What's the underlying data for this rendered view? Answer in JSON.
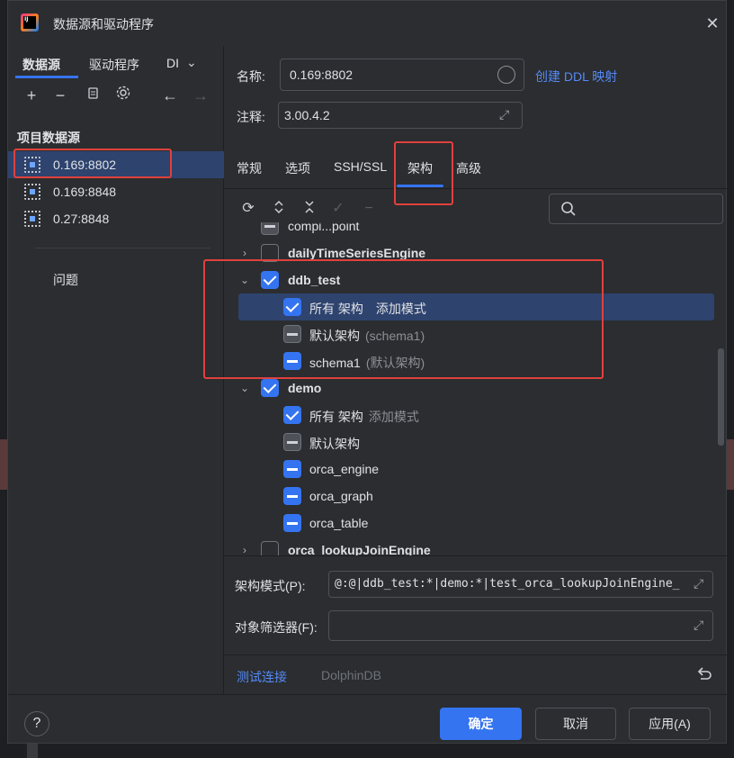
{
  "window": {
    "title": "数据源和驱动程序"
  },
  "left": {
    "tabs": [
      "数据源",
      "驱动程序",
      "DI"
    ],
    "section_title": "项目数据源",
    "datasources": [
      {
        "label": "0.169:8802",
        "selected": true
      },
      {
        "label": "0.169:8848",
        "selected": false
      },
      {
        "label": "0.27:8848",
        "selected": false
      }
    ],
    "problems": "问题"
  },
  "form": {
    "name_label": "名称:",
    "name_value": "0.169:8802",
    "ddl_link": "创建 DDL 映射",
    "comment_label": "注释:",
    "comment_value": "3.00.4.2"
  },
  "tabs": [
    "常规",
    "选项",
    "SSH/SSL",
    "架构",
    "高级"
  ],
  "active_tab": "架构",
  "tree": {
    "rows": [
      {
        "label": "compi...point",
        "level": 0,
        "check": "partial-gray"
      },
      {
        "label": "dailyTimeSeriesEngine",
        "level": 0,
        "check": "unchecked",
        "expand": "collapsed",
        "bold": true
      },
      {
        "label": "ddb_test",
        "level": 0,
        "check": "checked",
        "expand": "expanded",
        "bold": true
      },
      {
        "label": "所有 架构",
        "hint": "添加模式",
        "level": 1,
        "check": "checked",
        "selected": true
      },
      {
        "label": "默认架构",
        "hint": "(schema1)",
        "level": 1,
        "check": "partial-gray"
      },
      {
        "label": "schema1",
        "hint": "(默认架构)",
        "level": 1,
        "check": "partial-blue"
      },
      {
        "label": "demo",
        "level": 0,
        "check": "checked",
        "expand": "expanded",
        "bold": true
      },
      {
        "label": "所有 架构",
        "hint": "添加模式",
        "level": 1,
        "check": "checked"
      },
      {
        "label": "默认架构",
        "level": 1,
        "check": "partial-gray"
      },
      {
        "label": "orca_engine",
        "level": 1,
        "check": "partial-blue"
      },
      {
        "label": "orca_graph",
        "level": 1,
        "check": "partial-blue"
      },
      {
        "label": "orca_table",
        "level": 1,
        "check": "partial-blue"
      },
      {
        "label": "orca_lookupJoinEngine",
        "level": 0,
        "check": "unchecked",
        "expand": "collapsed",
        "bold": true
      }
    ]
  },
  "schema_pattern_label": "架构模式(P):",
  "schema_pattern_value": "@:@|ddb_test:*|demo:*|test_orca_lookupJoinEngine_",
  "object_filter_label": "对象筛选器(F):",
  "test_connection": "测试连接",
  "driver_name": "DolphinDB",
  "buttons": {
    "ok": "确定",
    "cancel": "取消",
    "apply": "应用(A)",
    "help": "?"
  }
}
